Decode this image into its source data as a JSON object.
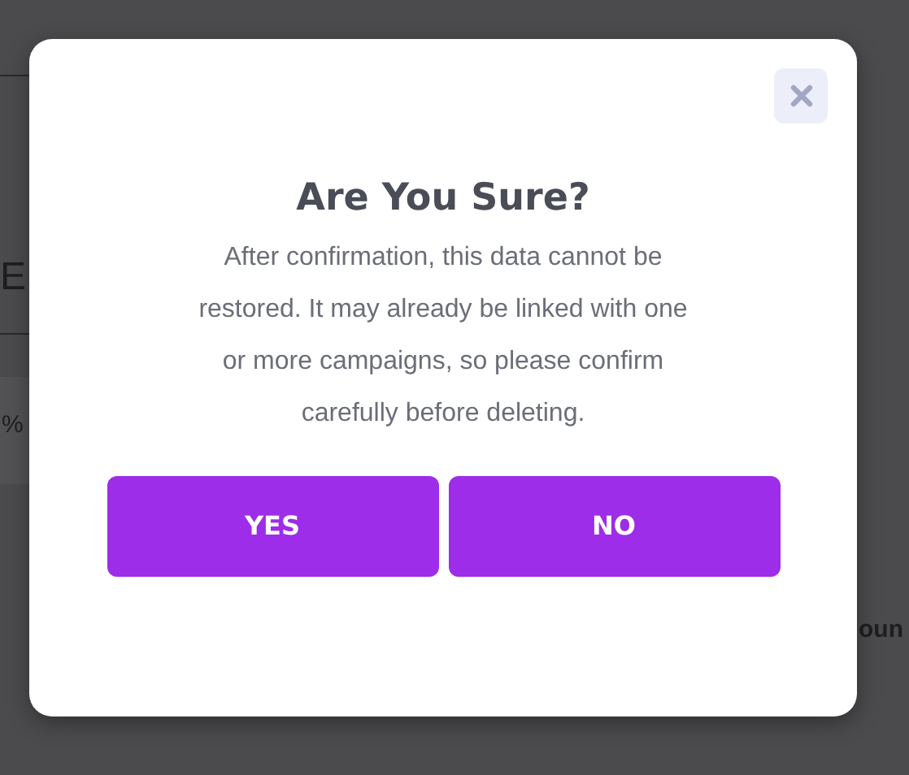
{
  "background": {
    "fragments": [
      "E",
      "%",
      "oun"
    ]
  },
  "dialog": {
    "title": "Are You Sure?",
    "message": "After confirmation, this data cannot be restored. It may already be linked with one or more campaigns, so please confirm carefully before deleting.",
    "buttons": [
      "YES",
      "NO"
    ]
  }
}
